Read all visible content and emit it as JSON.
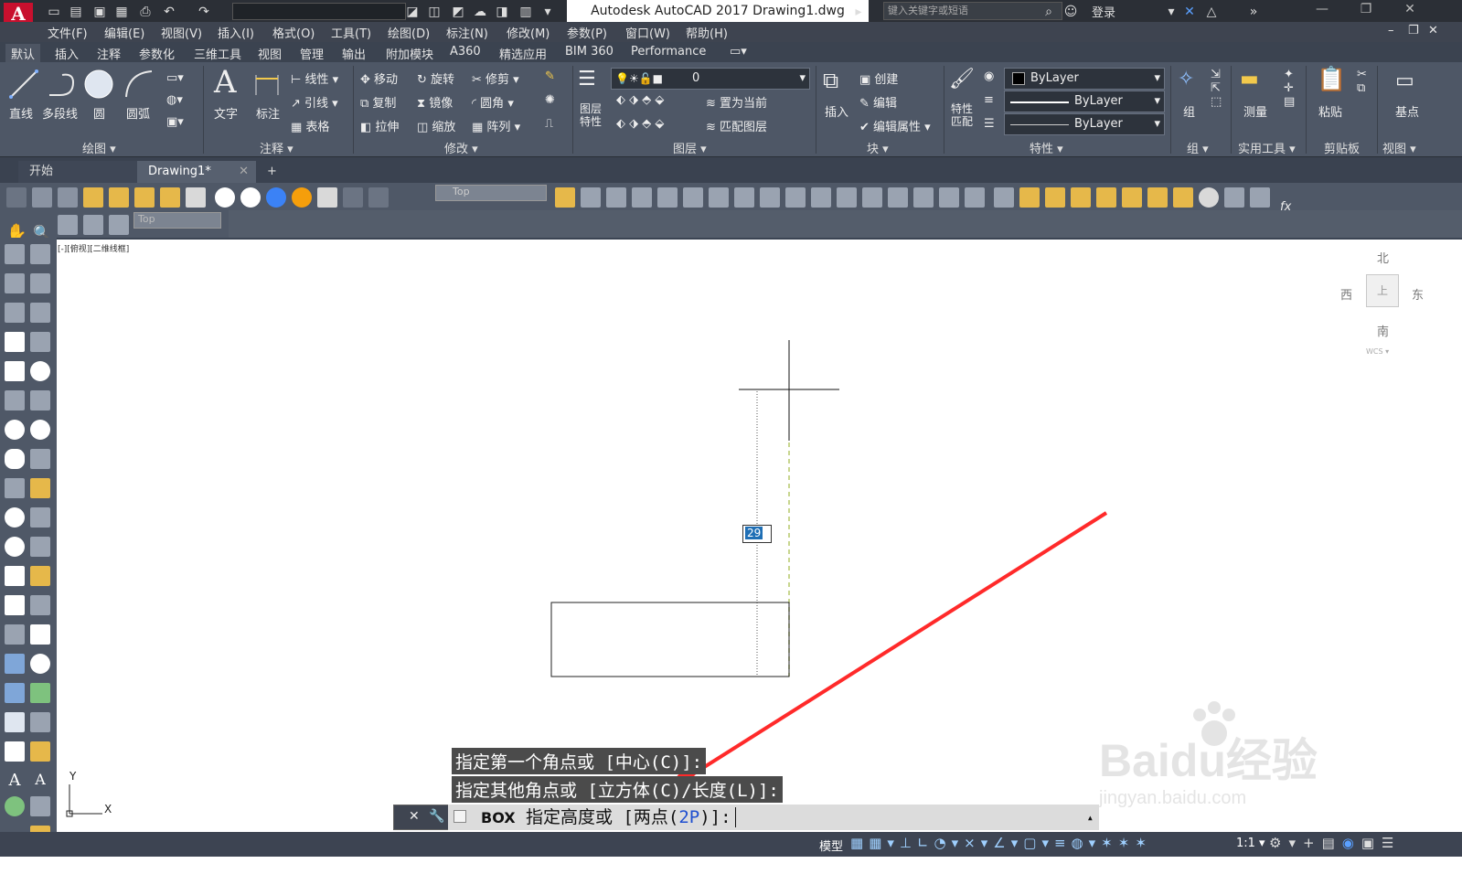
{
  "app": {
    "logo": "A",
    "title": "Autodesk AutoCAD 2017    Drawing1.dwg",
    "search_placeholder": "键入关键字或短语",
    "login": "登录",
    "workspace": ""
  },
  "menu": [
    "文件(F)",
    "编辑(E)",
    "视图(V)",
    "插入(I)",
    "格式(O)",
    "工具(T)",
    "绘图(D)",
    "标注(N)",
    "修改(M)",
    "参数(P)",
    "窗口(W)",
    "帮助(H)"
  ],
  "ribbon_tabs": [
    "默认",
    "插入",
    "注释",
    "参数化",
    "三维工具",
    "视图",
    "管理",
    "输出",
    "附加模块",
    "A360",
    "精选应用",
    "BIM 360",
    "Performance"
  ],
  "ribbon": {
    "draw": {
      "title": "绘图",
      "items": [
        "直线",
        "多段线",
        "圆",
        "圆弧"
      ]
    },
    "annotate": {
      "title": "注释",
      "items": [
        "文字",
        "标注",
        "线性",
        "引线",
        "表格"
      ]
    },
    "modify": {
      "title": "修改",
      "items": [
        "移动",
        "旋转",
        "修剪",
        "复制",
        "镜像",
        "圆角",
        "拉伸",
        "缩放",
        "阵列"
      ]
    },
    "layers": {
      "title": "图层",
      "layer_props": "图层\n特性",
      "current_layer": "0",
      "items": [
        "置为当前",
        "匹配图层"
      ]
    },
    "block": {
      "title": "块",
      "insert": "插入",
      "items": [
        "创建",
        "编辑",
        "编辑属性"
      ]
    },
    "properties": {
      "title": "特性",
      "match": "特性\n匹配",
      "color": "ByLayer",
      "linetype": "ByLayer",
      "lineweight": "ByLayer"
    },
    "groups": {
      "title": "组",
      "item": "组"
    },
    "utilities": {
      "title": "实用工具",
      "item": "测量"
    },
    "clipboard": {
      "title": "剪贴板",
      "item": "粘贴"
    },
    "view": {
      "title": "视图",
      "item": "基点"
    }
  },
  "doc_tabs": [
    {
      "label": "开始"
    },
    {
      "label": "Drawing1*"
    }
  ],
  "toolbar": {
    "view_combo": "Top",
    "view_combo2": "Top"
  },
  "viewport": {
    "label": "[-][俯视][二维线框]",
    "dynamic_input": "29",
    "viewcube": {
      "north": "北",
      "south": "南",
      "east": "东",
      "west": "西",
      "top": "上",
      "wcs": "WCS"
    },
    "ucs_x": "X",
    "ucs_y": "Y"
  },
  "command": {
    "history": [
      "指定第一个角点或 [中心(C)]:",
      "指定其他角点或 [立方体(C)/长度(L)]:"
    ],
    "prompt_name": "BOX",
    "prompt": "指定高度或 [两点(2P)]:",
    "option": "2P"
  },
  "status": {
    "model": "模型",
    "scale": "1:1"
  },
  "watermark": {
    "line1": "Baidu经验",
    "line2": "jingyan.baidu.com"
  },
  "colors": {
    "accent": "#c8102e",
    "ribbon": "#4e5766",
    "arrow": "#ff2a2a",
    "input_hl": "#1f6fb5"
  }
}
